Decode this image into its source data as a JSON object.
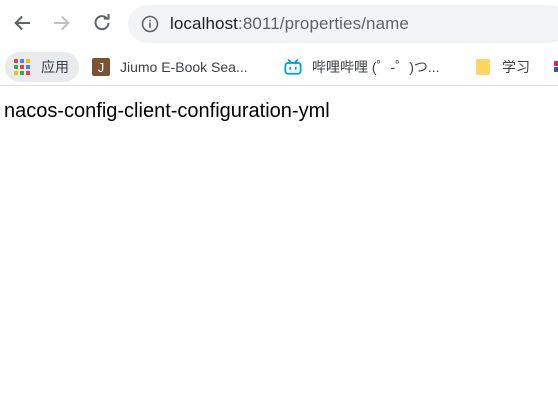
{
  "browser": {
    "toolbar": {
      "back_icon": "arrow-left-icon",
      "forward_icon": "arrow-right-icon",
      "reload_icon": "reload-icon",
      "info_icon": "info-icon",
      "url_host": "localhost",
      "url_rest": ":8011/properties/name"
    },
    "bookmarks": [
      {
        "icon": "apps-grid-icon",
        "label": "应用"
      },
      {
        "icon": "j-book-icon",
        "label": "Jiumo E-Book Sea..."
      },
      {
        "icon": "bilibili-icon",
        "label": "哔哩哔哩 (゜-゜)つ..."
      },
      {
        "icon": "folder-icon",
        "label": "学习"
      },
      {
        "icon": "colored-icon",
        "label": ""
      }
    ]
  },
  "page": {
    "body_text": "nacos-config-client-configuration-yml"
  },
  "colors": {
    "omnibox_bg": "#f1f3f4",
    "apps_pill_bg": "#e8eaed",
    "j_icon": "#7b5232",
    "bilibili": "#00a1d6",
    "folder": "#ffd666"
  }
}
